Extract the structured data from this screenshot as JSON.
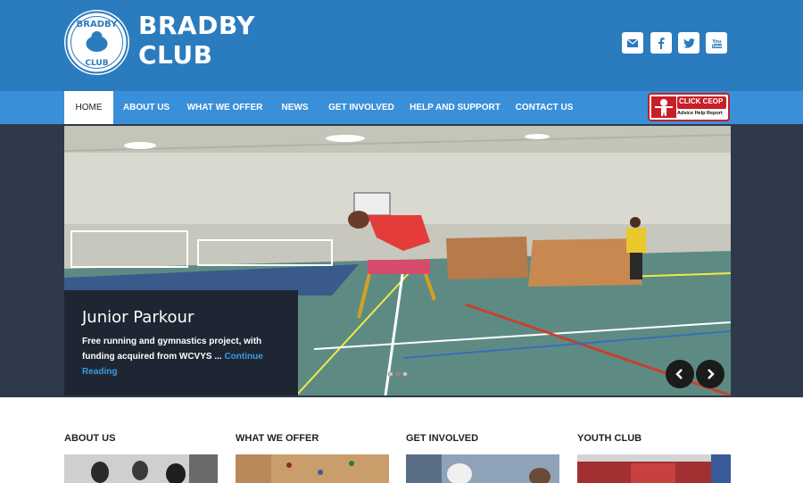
{
  "header": {
    "title_line1": "BRADBY",
    "title_line2": "CLUB",
    "logo_text_top": "BRADBY",
    "logo_text_bottom": "CLUB",
    "social": [
      {
        "icon": "mail-icon"
      },
      {
        "icon": "facebook-icon"
      },
      {
        "icon": "twitter-icon"
      },
      {
        "icon": "youtube-icon"
      }
    ]
  },
  "nav": {
    "items": [
      {
        "label": "HOME"
      },
      {
        "label": "ABOUT US"
      },
      {
        "label": "WHAT WE OFFER"
      },
      {
        "label": "NEWS"
      },
      {
        "label": "GET INVOLVED"
      },
      {
        "label": "HELP AND SUPPORT"
      },
      {
        "label": "CONTACT US"
      }
    ],
    "active_index": 0,
    "ceop": {
      "line1": "CLICK CEOP",
      "line2": "Advice Help Report"
    }
  },
  "slider": {
    "title": "Junior Parkour",
    "text": "Free running and gymnastics project, with funding acquired from WCVYS ...",
    "link": "Continue Reading",
    "dots_count": 3,
    "active_dot": 1,
    "prev_icon": "chevron-left-icon",
    "next_icon": "chevron-right-icon"
  },
  "sections": [
    {
      "title": "ABOUT US"
    },
    {
      "title": "WHAT WE OFFER"
    },
    {
      "title": "GET INVOLVED"
    },
    {
      "title": "YOUTH CLUB"
    }
  ],
  "colors": {
    "header_bg": "#2b7bbf",
    "nav_bg": "#3a8fd9",
    "slider_bg": "#2e3a49",
    "caption_bg": "#1f2633",
    "link": "#3a9ae0",
    "ceop_red": "#c62026"
  }
}
